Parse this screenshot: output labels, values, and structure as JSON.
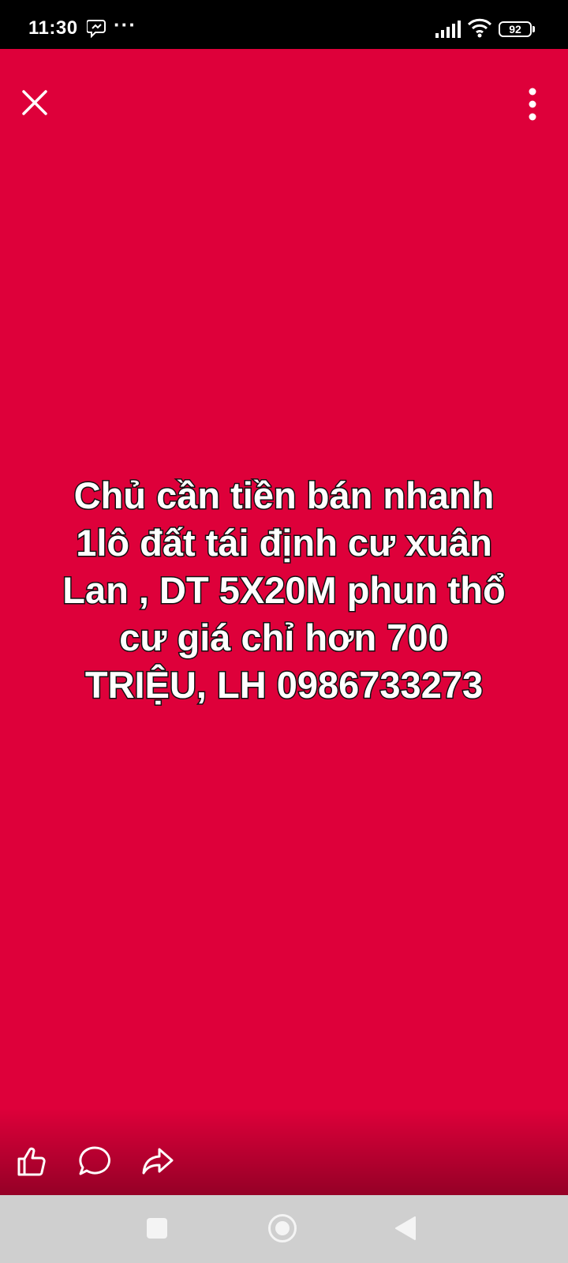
{
  "status_bar": {
    "time": "11:30",
    "more": "···",
    "battery": "92"
  },
  "story": {
    "background_color": "#de003a",
    "text": "Chủ cần tiền bán nhanh\n1lô đất tái định cư xuân\nLan , DT 5X20M phun thổ\ncư giá chỉ hơn 700\nTRIỆU, LH 0986733273",
    "icons": {
      "close": "close-icon",
      "more": "more-vertical-icon",
      "like": "thumbs-up-icon",
      "comment": "comment-icon",
      "share": "share-icon"
    }
  },
  "nav_bar": {
    "icons": [
      "recents-icon",
      "home-icon",
      "back-icon"
    ]
  }
}
